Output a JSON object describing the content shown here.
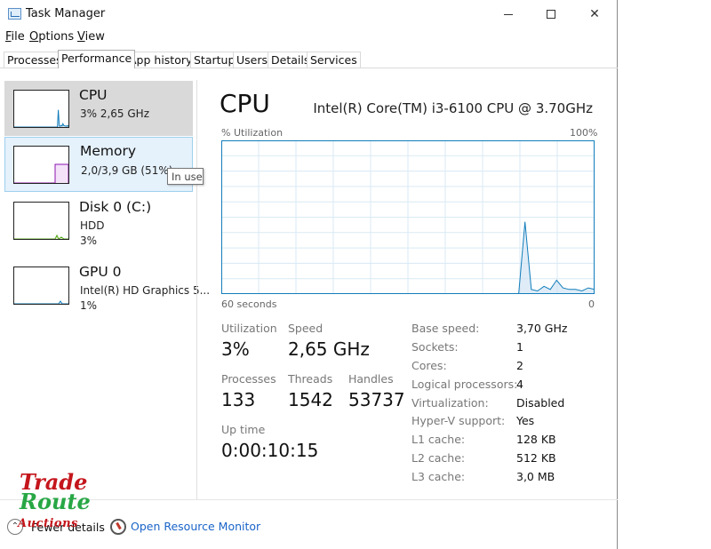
{
  "window": {
    "title": "Task Manager"
  },
  "menu": [
    {
      "underline": "F",
      "rest": "ile"
    },
    {
      "underline": "O",
      "rest": "ptions"
    },
    {
      "underline": "V",
      "rest": "iew"
    }
  ],
  "tabs": [
    "Processes",
    "Performance",
    "App history",
    "Startup",
    "Users",
    "Details",
    "Services"
  ],
  "active_tab": "Performance",
  "sidebar": {
    "items": [
      {
        "title": "CPU",
        "sub1": "3%  2,65 GHz",
        "sub2": "",
        "color": "#117dbb"
      },
      {
        "title": "Memory",
        "sub1": "2,0/3,9 GB (51%)",
        "sub2": "",
        "color": "#8b12ae"
      },
      {
        "title": "Disk 0 (C:)",
        "sub1": "HDD",
        "sub2": "3%",
        "color": "#4da60c"
      },
      {
        "title": "GPU 0",
        "sub1": "Intel(R) HD Graphics 5...",
        "sub2": "1%",
        "color": "#117dbb"
      }
    ],
    "tooltip": "In use"
  },
  "main": {
    "title": "CPU",
    "model": "Intel(R) Core(TM) i3-6100 CPU @ 3.70GHz",
    "graph": {
      "y_label": "% Utilization",
      "y_max_label": "100%",
      "x_left_label": "60 seconds",
      "x_right_label": "0",
      "color": "#117dbb",
      "fill": "#f1f6fa",
      "grid_color": "#d9eaf4"
    },
    "stats": {
      "utilization_label": "Utilization",
      "utilization": "3%",
      "speed_label": "Speed",
      "speed": "2,65 GHz",
      "processes_label": "Processes",
      "processes": "133",
      "threads_label": "Threads",
      "threads": "1542",
      "handles_label": "Handles",
      "handles": "53737",
      "uptime_label": "Up time",
      "uptime": "0:00:10:15"
    },
    "info": [
      {
        "label": "Base speed:",
        "value": "3,70 GHz"
      },
      {
        "label": "Sockets:",
        "value": "1"
      },
      {
        "label": "Cores:",
        "value": "2"
      },
      {
        "label": "Logical processors:",
        "value": "4"
      },
      {
        "label": "Virtualization:",
        "value": "Disabled"
      },
      {
        "label": "Hyper-V support:",
        "value": "Yes"
      },
      {
        "label": "L1 cache:",
        "value": "128 KB"
      },
      {
        "label": "L2 cache:",
        "value": "512 KB"
      },
      {
        "label": "L3 cache:",
        "value": "3,0 MB"
      }
    ]
  },
  "bottom": {
    "fewer_details": "Fewer details",
    "open_monitor": "Open Resource Monitor"
  },
  "watermark": {
    "line1": "Trade",
    "line2": "Route",
    "line3": "Auctions"
  },
  "cpu_history": [
    0,
    0,
    0,
    0,
    0,
    0,
    0,
    0,
    0,
    0,
    0,
    0,
    0,
    0,
    0,
    0,
    0,
    0,
    0,
    0,
    0,
    0,
    0,
    0,
    0,
    0,
    0,
    0,
    0,
    0,
    0,
    0,
    0,
    0,
    0,
    0,
    0,
    0,
    0,
    0,
    0,
    0,
    0,
    0,
    0,
    0,
    0,
    0,
    47,
    3,
    2,
    5,
    3,
    9,
    4,
    3,
    3,
    2,
    4,
    3
  ]
}
